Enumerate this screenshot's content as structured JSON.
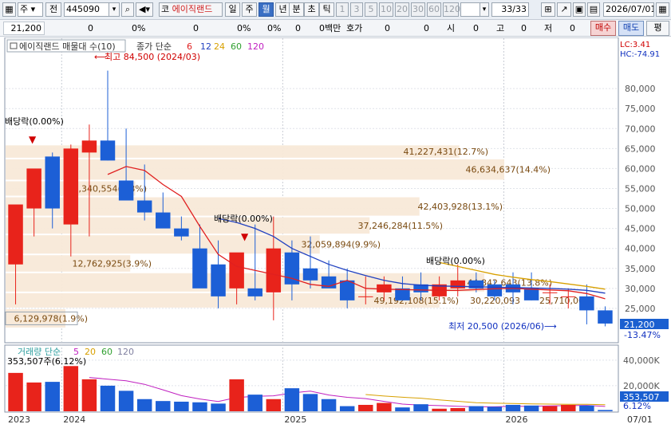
{
  "toolbar": {
    "market_label": "주",
    "period_label": "전",
    "code_value": "445090",
    "stock_name": "에이직랜드",
    "item_prefix": "코",
    "periods": [
      "일",
      "주",
      "월",
      "년",
      "분",
      "초",
      "틱"
    ],
    "selected_period": "월",
    "intervals": [
      "1",
      "3",
      "5",
      "10",
      "20",
      "30",
      "60",
      "120"
    ],
    "count_value": "33",
    "count_total": "/33",
    "date_value": "2026/07/01"
  },
  "info_bar": {
    "price": "21,200",
    "change": "0",
    "change_pct": "0%",
    "volume": "0",
    "volume_pct": "0%",
    "field4": "0",
    "field4_pct": "0%",
    "amount": "0백만",
    "quote_label": "호가",
    "bid": "0",
    "ask": "0",
    "open_label": "시",
    "open": "0",
    "high_label": "고",
    "high": "0",
    "low_label": "저",
    "low": "0",
    "buy_button": "매수",
    "sell_button": "매도",
    "eval_button": "평"
  },
  "legend": {
    "stock_legend": "에이직랜드 매물대 수(10)",
    "ma_legend_prefix": "종가 단순",
    "ma_periods": [
      "6",
      "12",
      "24",
      "60",
      "120"
    ],
    "ma_colors": [
      "#e02020",
      "#2040c0",
      "#d8a000",
      "#30a030",
      "#c020c0"
    ],
    "volume_legend_prefix": "거래량 단순",
    "volume_ma_periods": [
      "5",
      "20",
      "60",
      "120"
    ],
    "volume_ma_colors": [
      "#c020c0",
      "#d8a000",
      "#30a030",
      "#8080a0"
    ]
  },
  "annotations": {
    "high_marker": "최고 84,500 (2024/03)",
    "low_marker": "최저 20,500 (2026/06)",
    "dividend_labels": [
      "배당락(0.00%)",
      "배당락(0.00%)",
      "배당락(0.00%)"
    ],
    "lc_value": "LC:3.41",
    "hc_value": "HC:-74.91",
    "current_price": "21,200",
    "current_change": "-13.47%",
    "volume_current": "353,507",
    "volume_pct": "6.12%",
    "volume_peak": "353,507주(6.12%)"
  },
  "chart_data": [
    {
      "type": "candlestick",
      "title": "에이직랜드 매물대 수(10)",
      "x": [
        "2023/10",
        "2023/11",
        "2023/12",
        "2024/01",
        "2024/02",
        "2024/03",
        "2024/04",
        "2024/05",
        "2024/06",
        "2024/07",
        "2024/08",
        "2024/09",
        "2024/10",
        "2024/11",
        "2024/12",
        "2025/01",
        "2025/02",
        "2025/03",
        "2025/04",
        "2025/05",
        "2025/06",
        "2025/07",
        "2025/08",
        "2025/09",
        "2025/10",
        "2025/11",
        "2025/12",
        "2026/01",
        "2026/02",
        "2026/03",
        "2026/04",
        "2026/05",
        "2026/06"
      ],
      "open": [
        36000,
        50000,
        63000,
        46000,
        64000,
        67000,
        57000,
        52000,
        49000,
        45000,
        40000,
        36000,
        30000,
        30000,
        29000,
        39000,
        35000,
        33000,
        32000,
        28000,
        29000,
        30000,
        31000,
        28000,
        30000,
        32000,
        31000,
        31000,
        30000,
        29000,
        28000,
        28000,
        24500
      ],
      "high": [
        44000,
        57000,
        64000,
        66000,
        71000,
        84500,
        70000,
        61000,
        54000,
        48000,
        46000,
        42000,
        31000,
        46000,
        48000,
        42000,
        43000,
        37000,
        35000,
        33000,
        33000,
        33000,
        34000,
        33000,
        36000,
        34000,
        32000,
        34000,
        34000,
        31000,
        30000,
        31000,
        25500
      ],
      "low": [
        26000,
        43000,
        45000,
        38000,
        43000,
        62000,
        55000,
        47000,
        46000,
        42000,
        38000,
        25000,
        26000,
        27000,
        22000,
        27000,
        30000,
        31000,
        25000,
        26000,
        27000,
        27000,
        27000,
        27000,
        28000,
        29000,
        27000,
        26000,
        27000,
        26000,
        25000,
        21000,
        20500
      ],
      "close": [
        51000,
        60000,
        50000,
        65000,
        67000,
        62000,
        52000,
        49000,
        45000,
        43000,
        30000,
        28000,
        39000,
        28000,
        40000,
        31000,
        32000,
        30000,
        27000,
        28000,
        31000,
        27000,
        29000,
        31000,
        32000,
        30000,
        28000,
        29000,
        27000,
        29000,
        28000,
        24500,
        21200
      ],
      "volume": [
        300000,
        225000,
        230000,
        353507,
        250000,
        200000,
        160000,
        95000,
        80000,
        75000,
        70000,
        60000,
        250000,
        130000,
        95000,
        180000,
        135000,
        95000,
        40000,
        50000,
        65000,
        30000,
        55000,
        20000,
        25000,
        40000,
        35000,
        50000,
        45000,
        40000,
        50000,
        45000,
        10000
      ],
      "ma6": [
        null,
        null,
        null,
        null,
        null,
        58500,
        60500,
        59500,
        56000,
        53000,
        45500,
        38500,
        35500,
        34500,
        33500,
        32500,
        31000,
        30500,
        32000,
        30000,
        29800,
        29700,
        29600,
        29500,
        29500,
        29700,
        29900,
        30000,
        29800,
        29600,
        29400,
        28700,
        27400
      ],
      "ma12": [
        null,
        null,
        null,
        null,
        null,
        null,
        null,
        null,
        null,
        null,
        null,
        47500,
        46500,
        45000,
        43000,
        40000,
        38000,
        36000,
        34500,
        33200,
        32000,
        31200,
        30800,
        30600,
        30500,
        30400,
        30300,
        30200,
        30100,
        30000,
        29800,
        29500,
        28800
      ],
      "ma24": [
        null,
        null,
        null,
        null,
        null,
        null,
        null,
        null,
        null,
        null,
        null,
        null,
        null,
        null,
        null,
        null,
        null,
        null,
        null,
        null,
        null,
        null,
        null,
        36500,
        35500,
        34500,
        33500,
        32800,
        32200,
        31700,
        31100,
        30500,
        29800
      ],
      "volume_ma5": [
        null,
        null,
        null,
        null,
        264000,
        251000,
        238000,
        211000,
        168000,
        122000,
        96000,
        76000,
        107000,
        117000,
        121000,
        143000,
        158000,
        127000,
        109000,
        99000,
        77000,
        56000,
        48000,
        44000,
        39000,
        34000,
        35000,
        38000,
        39000,
        42000,
        44000,
        46000,
        38000
      ],
      "volume_ma20": [
        null,
        null,
        null,
        null,
        null,
        null,
        null,
        null,
        null,
        null,
        null,
        null,
        null,
        null,
        null,
        null,
        null,
        null,
        null,
        131000,
        119000,
        110000,
        102000,
        89000,
        78000,
        67000,
        63000,
        61000,
        58000,
        56000,
        54000,
        54000,
        52000
      ],
      "price_ylim": [
        17000,
        92000
      ],
      "volume_ylim": [
        0,
        480000
      ],
      "price_ticks": [
        "80,000",
        "75,000",
        "70,000",
        "65,000",
        "60,000",
        "55,000",
        "50,000",
        "45,000",
        "40,000",
        "35,000",
        "30,000",
        "25,000"
      ],
      "volume_ticks": [
        "40,000K",
        "20,000K"
      ],
      "x_tick_labels": [
        "2023",
        "2024",
        "2025",
        "2026"
      ],
      "x_right_label": "07/01",
      "volume_profile": [
        {
          "label": "41,227,431(12.7%)",
          "price_low": 62500,
          "price_high": 66000,
          "width": 0.91
        },
        {
          "label": "46,634,637(14.4%)",
          "price_low": 57000,
          "price_high": 62500,
          "width": 1.0
        },
        {
          "label": "12,340,554(3.8%)",
          "price_low": 53000,
          "price_high": 57000,
          "width": 0.26
        },
        {
          "label": "42,403,928(13.1%)",
          "price_low": 48000,
          "price_high": 53000,
          "width": 0.83
        },
        {
          "label": "37,246,284(11.5%)",
          "price_low": 43500,
          "price_high": 48000,
          "width": 0.73
        },
        {
          "label": "32,059,894(9.9%)",
          "price_low": 38500,
          "price_high": 43500,
          "width": 0.63
        },
        {
          "label": "12,762,925(3.9%)",
          "price_low": 34000,
          "price_high": 38500,
          "width": 0.25
        },
        {
          "label": "44,842,643(13.8%)",
          "price_low": 29000,
          "price_high": 34000,
          "width": 0.96
        },
        {
          "label": "49,192,108(15.1%)",
          "price_low": 25000,
          "price_high": 29000,
          "width": 0.87
        },
        {
          "label": "30,220,093",
          "price_low": 25000,
          "price_high": 29000,
          "width": 0
        },
        {
          "label": "25,710,06",
          "price_low": 25000,
          "price_high": 29000,
          "width": 0
        },
        {
          "label": "6,129,978(1.9%)",
          "price_low": 20000,
          "price_high": 25000,
          "width": 0.12
        }
      ]
    }
  ]
}
